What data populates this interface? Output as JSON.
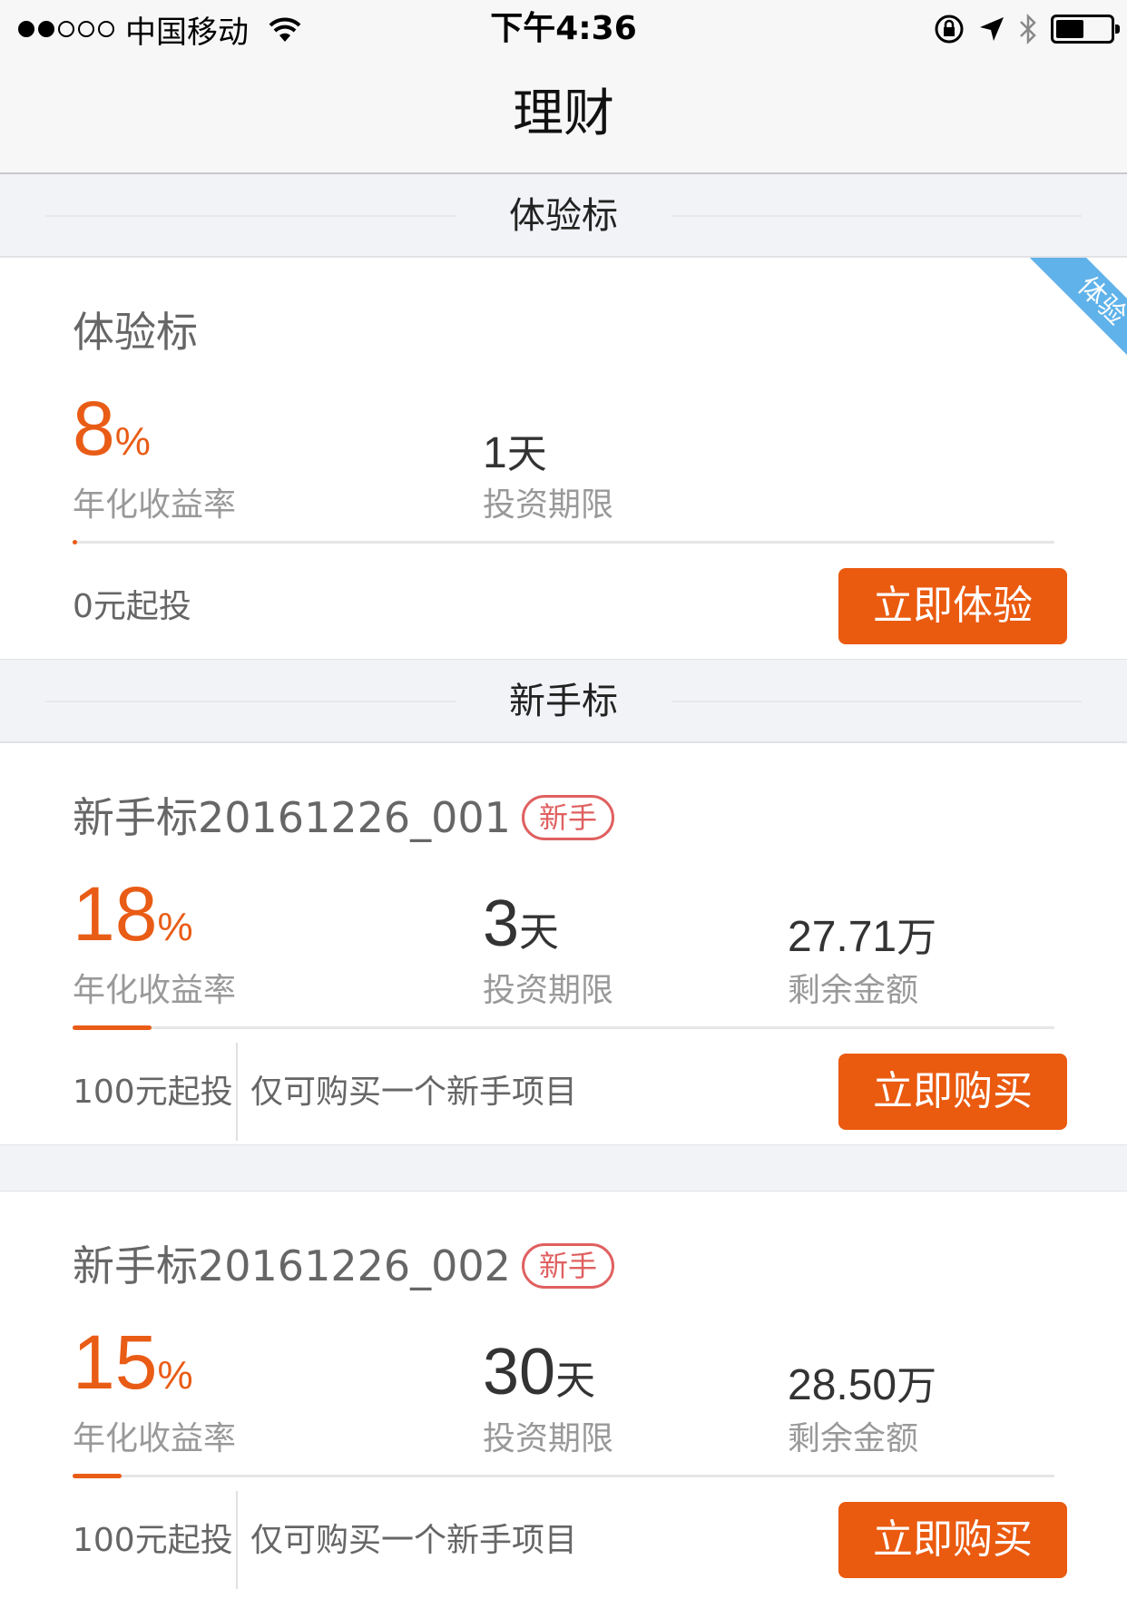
{
  "status_bar": {
    "carrier": "中国移动",
    "time": "下午4:36"
  },
  "nav": {
    "title": "理财"
  },
  "sections": {
    "experience": {
      "title": "体验标"
    },
    "newbie": {
      "title": "新手标"
    }
  },
  "cards": [
    {
      "name": "体验标",
      "ribbon": "体验",
      "rate": "8",
      "rate_unit": "%",
      "rate_label": "年化收益率",
      "term": "1",
      "term_unit": "天",
      "term_label": "投资期限",
      "progress": 0.005,
      "min_invest": "0元起投",
      "button": "立即体验"
    },
    {
      "name": "新手标20161226_001",
      "badge": "新手",
      "rate": "18",
      "rate_unit": "%",
      "rate_label": "年化收益率",
      "term": "3",
      "term_unit": "天",
      "term_label": "投资期限",
      "remaining": "27.71",
      "remaining_unit": "万",
      "remaining_label": "剩余金额",
      "progress": 0.08,
      "min_invest": "100元起投",
      "note": "仅可购买一个新手项目",
      "button": "立即购买"
    },
    {
      "name": "新手标20161226_002",
      "badge": "新手",
      "rate": "15",
      "rate_unit": "%",
      "rate_label": "年化收益率",
      "term": "30",
      "term_unit": "天",
      "term_label": "投资期限",
      "remaining": "28.50",
      "remaining_unit": "万",
      "remaining_label": "剩余金额",
      "progress": 0.05,
      "min_invest": "100元起投",
      "note": "仅可购买一个新手项目",
      "button": "立即购买"
    }
  ],
  "colors": {
    "accent": "#ea5a0f",
    "ribbon": "#5fb2ea",
    "badge": "#e06060"
  }
}
